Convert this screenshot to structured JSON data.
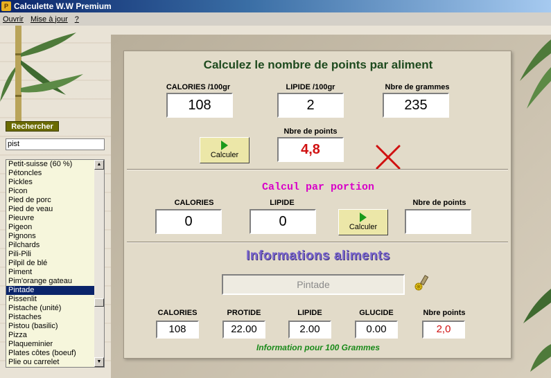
{
  "window": {
    "title": "Calculette W.W Premium",
    "icon": "app-icon"
  },
  "menu": [
    "Ouvrir",
    "Mise à jour",
    "?"
  ],
  "sidebar": {
    "search_button": "Rechercher",
    "search_value": "pist",
    "selected_index": 14,
    "items": [
      "Petit-suisse (60 %)",
      "Pétoncles",
      "Pickles",
      "Picon",
      "Pied de porc",
      "Pied de veau",
      "Pieuvre",
      "Pigeon",
      "Pignons",
      "Pilchards",
      "Pili-Pili",
      "Pilpil de blé",
      "Piment",
      "Pim'orange gateau",
      "Pintade",
      "Pissenlit",
      "Pistache (unité)",
      "Pistaches",
      "Pistou (basilic)",
      "Pizza",
      "Plaqueminier",
      "Plates côtes (boeuf)",
      "Plie ou carrelet"
    ]
  },
  "calc": {
    "heading": "Calculez le nombre de points par aliment",
    "calories_label": "CALORIES /100gr",
    "calories_value": "108",
    "lipide_label": "LIPIDE /100gr",
    "lipide_value": "2",
    "grams_label": "Nbre de grammes",
    "grams_value": "235",
    "points_label": "Nbre de points",
    "points_value": "4,8",
    "button_label": "Calculer"
  },
  "portion": {
    "heading": "Calcul par portion",
    "calories_label": "CALORIES",
    "calories_value": "0",
    "lipide_label": "LIPIDE",
    "lipide_value": "0",
    "button_label": "Calculer",
    "points_label": "Nbre de points",
    "points_value": ""
  },
  "info": {
    "heading": "Informations aliments",
    "food_name": "Pintade",
    "calories_label": "CALORIES",
    "calories_value": "108",
    "protide_label": "PROTIDE",
    "protide_value": "22.00",
    "lipide_label": "LIPIDE",
    "lipide_value": "2.00",
    "glucide_label": "GLUCIDE",
    "glucide_value": "0.00",
    "points_label": "Nbre points",
    "points_value": "2,0",
    "note": "Information pour 100 Grammes"
  },
  "colors": {
    "heading": "#1e4a1e",
    "portion_heading": "#d800c8",
    "info_heading": "#7a66cc",
    "points_red": "#d01010",
    "note_green": "#1a8a1a"
  }
}
